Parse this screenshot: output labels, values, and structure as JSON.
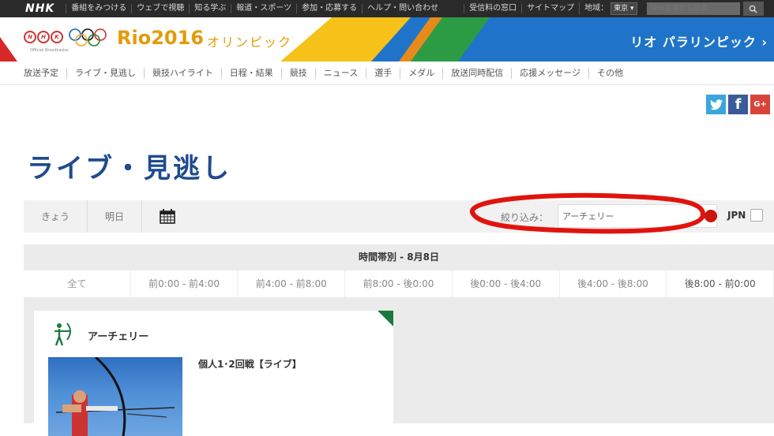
{
  "topbar": {
    "logo": "NHK",
    "links": [
      "番組をみつける",
      "ウェブで視聴",
      "知る学ぶ",
      "報道・スポーツ",
      "参加・応募する",
      "ヘルプ・問い合わせ",
      "受信料の窓口",
      "サイトマップ"
    ],
    "region_label": "地域：",
    "region_value": "東京",
    "search_placeholder": "NHK全体から検索"
  },
  "banner": {
    "rio_title": "Rio2016",
    "olympic_jp": "オリンピック",
    "broadcaster": "Official Broadcaster",
    "paralympic_link": "リオ パラリンピック ›"
  },
  "nav": {
    "items": [
      "放送予定",
      "ライブ・見逃し",
      "競技ハイライト",
      "日程・結果",
      "競技",
      "ニュース",
      "選手",
      "メダル",
      "放送同時配信",
      "応援メッセージ",
      "その他"
    ]
  },
  "social": {
    "twitter": "t",
    "facebook": "f",
    "googleplus": "G+"
  },
  "page": {
    "title": "ライブ・見逃し"
  },
  "filter": {
    "today": "きょう",
    "tomorrow": "明日",
    "label": "絞り込み：",
    "select_value": "アーチェリー",
    "jpn_label": "JPN"
  },
  "timeline": {
    "title": "時間帯別 - 8月8日",
    "tabs": [
      "全て",
      "前0:00 - 前4:00",
      "前4:00 - 前8:00",
      "前8:00 - 後0:00",
      "後0:00 - 後4:00",
      "後4:00 - 後8:00",
      "後8:00 - 前0:00"
    ]
  },
  "card": {
    "sport": "アーチェリー",
    "event": "個人1･2回戦【ライブ】"
  },
  "colors": {
    "title_blue": "#1f4b8f",
    "accent_orange": "#e39b0b",
    "jpn_red": "#c8160c",
    "annotation_red": "#e0140f"
  }
}
